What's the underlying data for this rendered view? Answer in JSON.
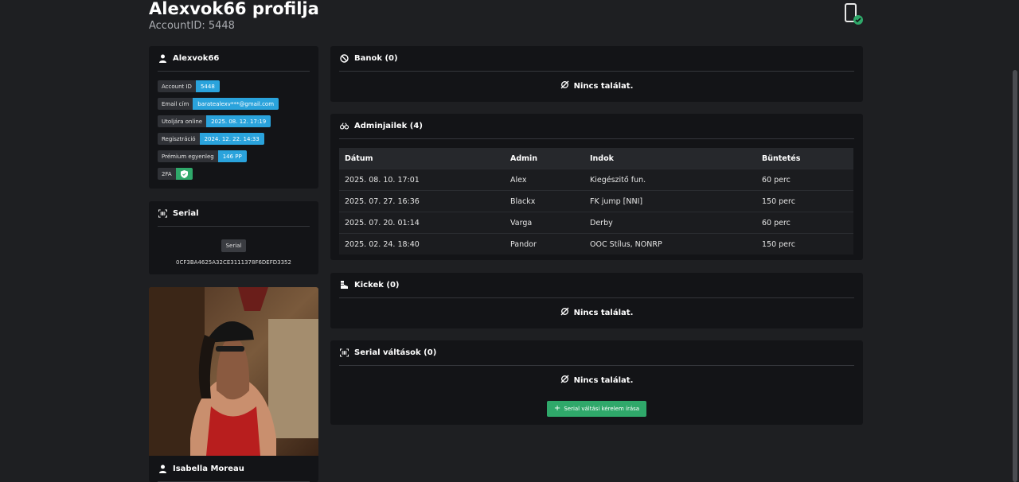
{
  "header": {
    "title": "Alexvok66 profilja",
    "subtitle": "AccountID: 5448"
  },
  "account": {
    "name": "Alexvok66",
    "fields": [
      {
        "label": "Account ID",
        "value": "5448"
      },
      {
        "label": "Email cím",
        "value": "baratealexv***@gmail.com"
      },
      {
        "label": "Utoljára online",
        "value": "2025. 08. 12. 17:19"
      },
      {
        "label": "Regisztráció",
        "value": "2024. 12. 22. 14:33"
      },
      {
        "label": "Prémium egyenleg",
        "value": "146 PP"
      },
      {
        "label": "2FA",
        "value": ""
      }
    ]
  },
  "serial": {
    "title": "Serial",
    "badge": "Serial",
    "value": "0CF3BA4625A32CE3111378F6DEFD3352"
  },
  "character": {
    "name": "Isabella Moreau"
  },
  "bans": {
    "title": "Banok (0)",
    "empty": "Nincs találat."
  },
  "adminjail": {
    "title": "Adminjailek (4)",
    "columns": [
      "Dátum",
      "Admin",
      "Indok",
      "Büntetés"
    ],
    "rows": [
      [
        "2025. 08. 10. 17:01",
        "Alex",
        "Kiegészitő fun.",
        "60 perc"
      ],
      [
        "2025. 07. 27. 16:36",
        "Blackx",
        "FK jump [NNI]",
        "150 perc"
      ],
      [
        "2025. 07. 20. 01:14",
        "Varga",
        "Derby",
        "60 perc"
      ],
      [
        "2025. 02. 24. 18:40",
        "Pandor",
        "OOC Stílus, NONRP",
        "150 perc"
      ]
    ]
  },
  "kicks": {
    "title": "Kickek (0)",
    "empty": "Nincs találat."
  },
  "serialchanges": {
    "title": "Serial váltások (0)",
    "empty": "Nincs találat.",
    "button": "Serial váltási kérelem írása"
  },
  "colors": {
    "accent_blue": "#2aa3dc",
    "accent_green": "#2fa86a",
    "card_bg": "#131417",
    "page_bg": "#1e1f22"
  }
}
